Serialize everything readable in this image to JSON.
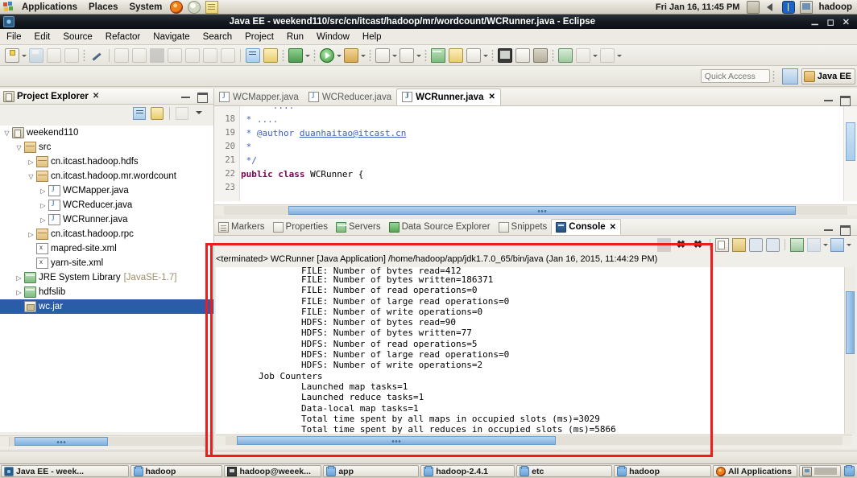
{
  "gnome_top": {
    "menus": [
      "Applications",
      "Places",
      "System"
    ],
    "launchers": [
      "firefox-icon",
      "paint-icon",
      "text-editor-icon"
    ],
    "clock": "Fri Jan 16, 11:45 PM",
    "tray": [
      "package-update-icon",
      "volume-icon",
      "bluetooth-icon",
      "display-icon"
    ],
    "user": "hadoop"
  },
  "window": {
    "title": "Java EE - weekend110/src/cn/itcast/hadoop/mr/wordcount/WCRunner.java - Eclipse",
    "buttons": [
      "minimize",
      "maximize",
      "close"
    ],
    "window_icon": "eclipse-icon"
  },
  "menubar": {
    "items": [
      "File",
      "Edit",
      "Source",
      "Refactor",
      "Navigate",
      "Search",
      "Project",
      "Run",
      "Window",
      "Help"
    ]
  },
  "toolbar": {
    "groups": [
      [
        "new-wizard-icon",
        "new-wizard-dropdown"
      ],
      [
        "save-icon",
        "save-all-icon",
        "print-icon"
      ],
      [
        "pen-icon"
      ],
      [
        "run-last-icon",
        "debug-icon",
        "stop-icon",
        "next-annotation-icon",
        "previous-annotation-icon",
        "back-icon",
        "forward-icon"
      ],
      [
        "open-type-icon",
        "new-java-class-icon"
      ],
      [
        "run-icon",
        "run-dropdown"
      ],
      [
        "debug-run-icon",
        "debug-dropdown"
      ],
      [
        "external-tools-icon",
        "external-tools-dropdown"
      ],
      [
        "search-icon",
        "search-dropdown"
      ],
      [
        "bookmark-icon",
        "tag-icon",
        "annotate-icon",
        "annotate-dropdown"
      ],
      [
        "terminal-icon",
        "server-icon",
        "globe-icon"
      ],
      [
        "link-icon",
        "nav-back-icon",
        "nav-back-dropdown",
        "nav-forward-icon",
        "nav-forward-dropdown"
      ]
    ]
  },
  "quick_access": {
    "placeholder": "Quick Access",
    "open_perspective_icon": "open-perspective-icon",
    "perspective_label": "Java EE",
    "perspective_icon": "java-ee-perspective-icon"
  },
  "project_explorer": {
    "tab_label": "Project Explorer",
    "tab_icon": "project-explorer-icon",
    "close_glyph": "✕",
    "view_controls": [
      "minimize-icon",
      "maximize-icon"
    ],
    "toolbar_icons": [
      "collapse-all-icon",
      "link-with-editor-icon",
      "focus-icon",
      "view-menu-icon"
    ],
    "tree": [
      {
        "label": "weekend110",
        "indent": 0,
        "arrow": "open",
        "icon": "java-project-icon"
      },
      {
        "label": "src",
        "indent": 1,
        "arrow": "open",
        "icon": "source-folder-icon"
      },
      {
        "label": "cn.itcast.hadoop.hdfs",
        "indent": 2,
        "arrow": "closed",
        "icon": "package-icon"
      },
      {
        "label": "cn.itcast.hadoop.mr.wordcount",
        "indent": 2,
        "arrow": "open",
        "icon": "package-icon"
      },
      {
        "label": "WCMapper.java",
        "indent": 3,
        "arrow": "closed",
        "icon": "java-file-icon"
      },
      {
        "label": "WCReducer.java",
        "indent": 3,
        "arrow": "closed",
        "icon": "java-file-icon"
      },
      {
        "label": "WCRunner.java",
        "indent": 3,
        "arrow": "closed",
        "icon": "java-file-icon"
      },
      {
        "label": "cn.itcast.hadoop.rpc",
        "indent": 2,
        "arrow": "closed",
        "icon": "package-icon"
      },
      {
        "label": "mapred-site.xml",
        "indent": 2,
        "arrow": "none",
        "icon": "xml-file-icon"
      },
      {
        "label": "yarn-site.xml",
        "indent": 2,
        "arrow": "none",
        "icon": "xml-file-icon"
      },
      {
        "label": "JRE System Library",
        "suffix": "[JavaSE-1.7]",
        "indent": 1,
        "arrow": "closed",
        "icon": "library-icon"
      },
      {
        "label": "hdfslib",
        "indent": 1,
        "arrow": "closed",
        "icon": "library-icon"
      },
      {
        "label": "wc.jar",
        "indent": 1,
        "arrow": "none",
        "icon": "jar-file-icon",
        "selected": true
      }
    ]
  },
  "editor": {
    "tabs": [
      {
        "label": "WCMapper.java",
        "icon": "java-file-icon",
        "active": false
      },
      {
        "label": "WCReducer.java",
        "icon": "java-file-icon",
        "active": false
      },
      {
        "label": "WCRunner.java",
        "icon": "java-file-icon",
        "active": true,
        "close_glyph": "✕"
      }
    ],
    "controls": [
      "minimize-icon",
      "maximize-icon"
    ],
    "line_numbers": [
      "18",
      "19",
      "20",
      "21",
      "22",
      "23"
    ],
    "lines": [
      {
        "num": "18",
        "segments": [
          {
            "t": " * ....",
            "c": "jdoc"
          }
        ]
      },
      {
        "num": "19",
        "segments": [
          {
            "t": " * @author ",
            "c": "jdoc"
          },
          {
            "t": "duanhaitao@itcast.cn",
            "c": "jdoc-link"
          }
        ]
      },
      {
        "num": "20",
        "segments": [
          {
            "t": " *",
            "c": "jdoc"
          }
        ]
      },
      {
        "num": "21",
        "segments": [
          {
            "t": " */",
            "c": "jdoc"
          }
        ]
      },
      {
        "num": "22",
        "segments": [
          {
            "t": "public class ",
            "c": "kw"
          },
          {
            "t": "WCRunner {",
            "c": "cls"
          }
        ]
      },
      {
        "num": "23",
        "segments": [
          {
            "t": "",
            "c": "cls"
          }
        ]
      }
    ]
  },
  "bottom_panel": {
    "tabs": [
      {
        "label": "Markers",
        "icon": "markers-icon",
        "active": false
      },
      {
        "label": "Properties",
        "icon": "properties-icon",
        "active": false
      },
      {
        "label": "Servers",
        "icon": "servers-icon",
        "active": false
      },
      {
        "label": "Data Source Explorer",
        "icon": "data-source-icon",
        "active": false
      },
      {
        "label": "Snippets",
        "icon": "snippets-icon",
        "active": false
      },
      {
        "label": "Console",
        "icon": "console-icon",
        "active": true,
        "close_glyph": "✕"
      }
    ],
    "controls": [
      "minimize-icon",
      "maximize-icon"
    ],
    "toolbar_icons": [
      "terminate-icon",
      "remove-launch-icon",
      "remove-all-terminated-icon",
      "clear-console-icon",
      "scroll-lock-icon",
      "show-console-on-output-icon",
      "show-console-on-error-icon",
      "pin-console-icon",
      "display-selected-console-icon",
      "display-selected-dropdown",
      "open-console-icon",
      "open-console-dropdown"
    ]
  },
  "console": {
    "header": "<terminated> WCRunner [Java Application] /home/hadoop/app/jdk1.7.0_65/bin/java (Jan 16, 2015, 11:44:29 PM)",
    "lines": [
      "                FILE: Number of bytes read=412",
      "                FILE: Number of bytes written=186371",
      "                FILE: Number of read operations=0",
      "                FILE: Number of large read operations=0",
      "                FILE: Number of write operations=0",
      "                HDFS: Number of bytes read=90",
      "                HDFS: Number of bytes written=77",
      "                HDFS: Number of read operations=5",
      "                HDFS: Number of large read operations=0",
      "                HDFS: Number of write operations=2",
      "        Job Counters",
      "                Launched map tasks=1",
      "                Launched reduce tasks=1",
      "                Data-local map tasks=1",
      "                Total time spent by all maps in occupied slots (ms)=3029",
      "                Total time spent by all reduces in occupied slots (ms)=5866"
    ]
  },
  "gnome_bottom": {
    "items": [
      {
        "label": "Java EE - week...",
        "icon": "eclipse-icon"
      },
      {
        "label": "hadoop",
        "icon": "folder-icon"
      },
      {
        "label": "hadoop@weeek...",
        "icon": "terminal-icon"
      },
      {
        "label": "app",
        "icon": "folder-icon"
      },
      {
        "label": "hadoop-2.4.1",
        "icon": "folder-icon"
      },
      {
        "label": "etc",
        "icon": "folder-icon"
      },
      {
        "label": "hadoop",
        "icon": "folder-icon"
      },
      {
        "label": "All Applications",
        "icon": "all-applications-icon"
      }
    ],
    "tray": [
      "workspace-switcher-icon",
      "trash-icon"
    ]
  },
  "annotations": {
    "highlight_color": "#ee1c1c",
    "boxes": [
      "console-view-highlight",
      "project-explorer-selection-highlight"
    ]
  }
}
